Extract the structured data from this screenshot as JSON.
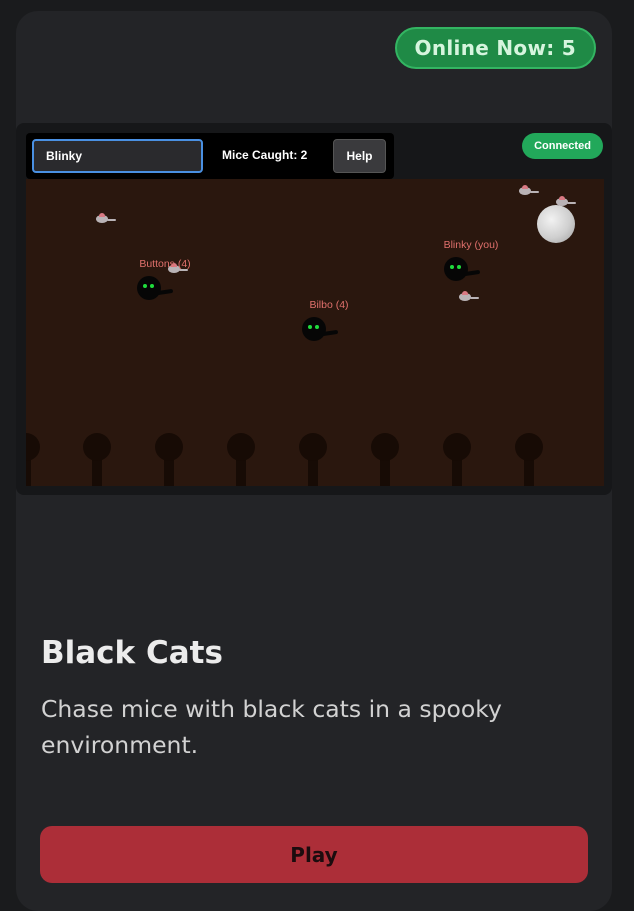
{
  "header": {
    "online_now": "Online Now: 5"
  },
  "game_preview": {
    "hud": {
      "player_name_value": "Blinky",
      "mice_caught": "Mice Caught: 2",
      "help_label": "Help"
    },
    "status": "Connected",
    "players": [
      {
        "label": "Buttons (4)"
      },
      {
        "label": "Bilbo (4)"
      },
      {
        "label": "Blinky (you)"
      }
    ]
  },
  "game": {
    "title": "Black Cats",
    "description": "Chase mice with black cats in a spooky environment.",
    "play_label": "Play"
  }
}
